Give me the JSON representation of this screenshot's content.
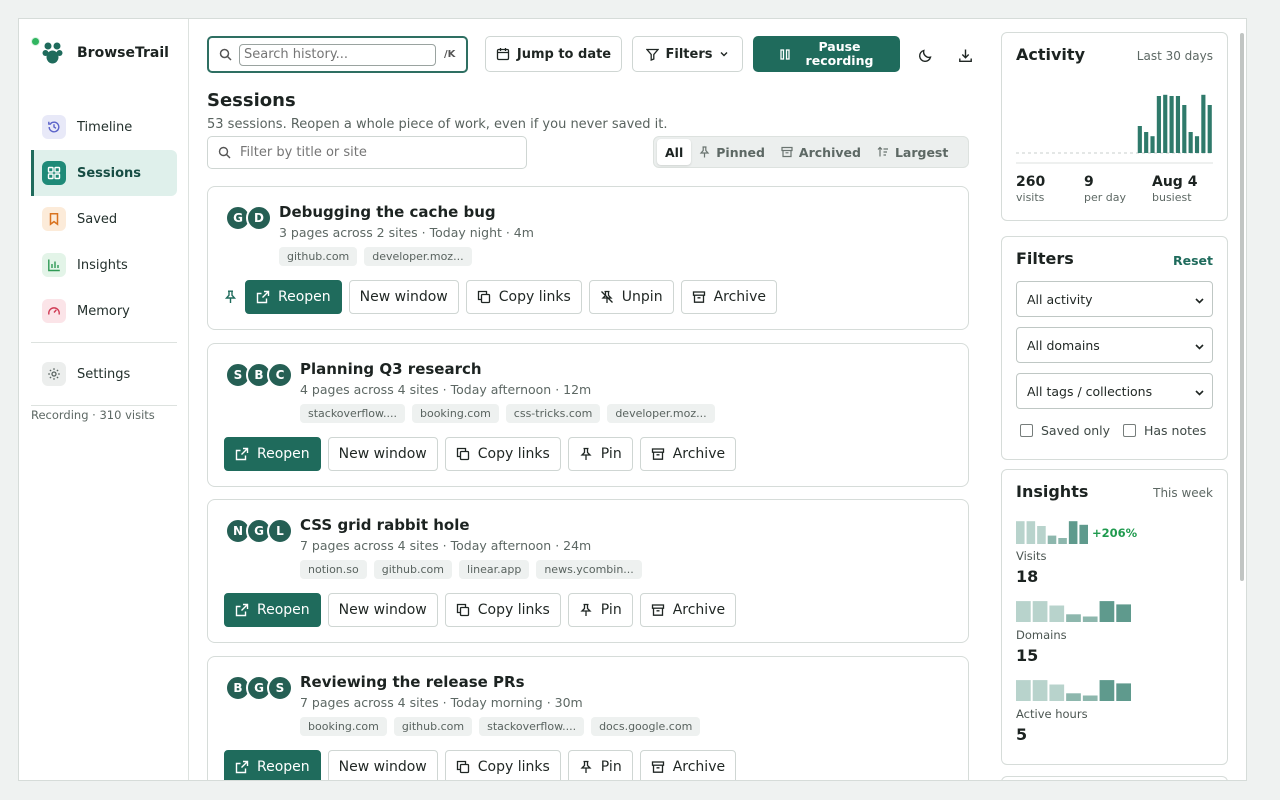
{
  "app": {
    "name": "BrowseTrail"
  },
  "sidebar": {
    "items": [
      {
        "label": "Timeline",
        "icon": "history-icon"
      },
      {
        "label": "Sessions",
        "icon": "grid-icon"
      },
      {
        "label": "Saved",
        "icon": "bookmark-icon"
      },
      {
        "label": "Insights",
        "icon": "bar-chart-icon"
      },
      {
        "label": "Memory",
        "icon": "gauge-icon"
      },
      {
        "label": "Settings",
        "icon": "gear-icon"
      }
    ],
    "active": "Sessions",
    "status": "Recording · 310 visits"
  },
  "toolbar": {
    "search_placeholder": "Search history...",
    "shortcut": "/K",
    "jump_label": "Jump to date",
    "filters_label": "Filters",
    "pause_label_line1": "Pause",
    "pause_label_line2": "recording"
  },
  "main": {
    "title": "Sessions",
    "subtitle": "53 sessions. Reopen a whole piece of work, even if you never saved it.",
    "filter_placeholder": "Filter by title or site",
    "segments": [
      "All",
      "Pinned",
      "Archived",
      "Largest"
    ],
    "active_segment": "All"
  },
  "sessions": [
    {
      "avatars": [
        "G",
        "D"
      ],
      "title": "Debugging the cache bug",
      "meta": "3 pages across 2 sites · Today night · 4m",
      "chips": [
        "github.com",
        "developer.moz..."
      ],
      "pinned": true,
      "actions": [
        "Reopen",
        "New window",
        "Copy links",
        "Unpin",
        "Archive"
      ]
    },
    {
      "avatars": [
        "S",
        "B",
        "C"
      ],
      "title": "Planning Q3 research",
      "meta": "4 pages across 4 sites · Today afternoon · 12m",
      "chips": [
        "stackoverflow....",
        "booking.com",
        "css-tricks.com",
        "developer.moz..."
      ],
      "pinned": false,
      "actions": [
        "Reopen",
        "New window",
        "Copy links",
        "Pin",
        "Archive"
      ]
    },
    {
      "avatars": [
        "N",
        "G",
        "L"
      ],
      "title": "CSS grid rabbit hole",
      "meta": "7 pages across 4 sites · Today afternoon · 24m",
      "chips": [
        "notion.so",
        "github.com",
        "linear.app",
        "news.ycombin..."
      ],
      "pinned": false,
      "actions": [
        "Reopen",
        "New window",
        "Copy links",
        "Pin",
        "Archive"
      ]
    },
    {
      "avatars": [
        "B",
        "G",
        "S"
      ],
      "title": "Reviewing the release PRs",
      "meta": "7 pages across 4 sites · Today morning · 30m",
      "chips": [
        "booking.com",
        "github.com",
        "stackoverflow....",
        "docs.google.com"
      ],
      "pinned": false,
      "actions": [
        "Reopen",
        "New window",
        "Copy links",
        "Pin",
        "Archive"
      ]
    }
  ],
  "activity": {
    "title": "Activity",
    "range": "Last 30 days",
    "bars": [
      0,
      0,
      0,
      0,
      0,
      0,
      0,
      0,
      0,
      0,
      0,
      0,
      0,
      0,
      0,
      0,
      0,
      0,
      0,
      0.45,
      0.35,
      0.28,
      0.95,
      0.97,
      0.95,
      0.95,
      0.8,
      0.35,
      0.28,
      0.97,
      0.8
    ],
    "stats": [
      {
        "value": "260",
        "label": "visits"
      },
      {
        "value": "9",
        "label": "per day"
      },
      {
        "value": "Aug 4",
        "label": "busiest"
      }
    ]
  },
  "filters_panel": {
    "title": "Filters",
    "reset_label": "Reset",
    "selects": [
      "All activity",
      "All domains",
      "All tags / collections"
    ],
    "checkboxes": [
      "Saved only",
      "Has notes"
    ]
  },
  "insights": {
    "title": "Insights",
    "range": "This week",
    "metrics": [
      {
        "label": "Visits",
        "value": "18",
        "change": "+206%",
        "bars": [
          0.95,
          0.95,
          0.75,
          0.35,
          0.25,
          0.95,
          0.8
        ]
      },
      {
        "label": "Domains",
        "value": "15",
        "change": "",
        "bars": [
          0.95,
          0.95,
          0.75,
          0.35,
          0.25,
          0.95,
          0.8
        ]
      },
      {
        "label": "Active hours",
        "value": "5",
        "change": "",
        "bars": [
          0.95,
          0.95,
          0.75,
          0.35,
          0.25,
          0.95,
          0.8
        ]
      }
    ]
  },
  "colors": {
    "accent": "#1f6b5c",
    "positive": "#1f9a4e",
    "recording_dot": "#31b560"
  }
}
